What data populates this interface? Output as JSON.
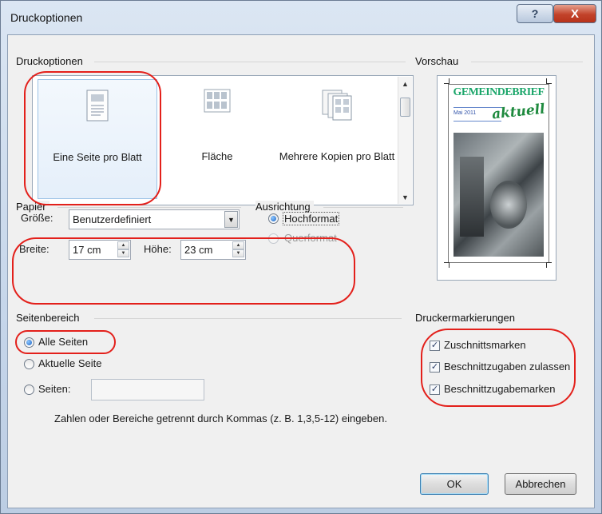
{
  "window": {
    "title": "Druckoptionen",
    "help_glyph": "?",
    "close_glyph": "X"
  },
  "layout_group": {
    "label": "Druckoptionen",
    "options": [
      {
        "label": "Eine Seite pro Blatt",
        "selected": true,
        "icon": "single-page-icon"
      },
      {
        "label": "Fläche",
        "selected": false,
        "icon": "tiled-pages-icon"
      },
      {
        "label": "Mehrere Kopien pro Blatt",
        "selected": false,
        "icon": "multiple-copies-icon"
      }
    ]
  },
  "preview": {
    "label": "Vorschau",
    "headline": "GEMEINDEBRIEF",
    "subline": "aktuell",
    "date": "Mai 2011"
  },
  "paper": {
    "label": "Papier",
    "size_label": "Größe:",
    "size_value": "Benutzerdefiniert",
    "width_label": "Breite:",
    "width_value": "17 cm",
    "height_label": "Höhe:",
    "height_value": "23 cm"
  },
  "orientation": {
    "label": "Ausrichtung",
    "portrait": "Hochformat",
    "landscape": "Querformat",
    "selected": "portrait"
  },
  "page_range": {
    "label": "Seitenbereich",
    "all": "Alle Seiten",
    "current": "Aktuelle Seite",
    "pages": "Seiten:",
    "pages_value": "",
    "hint": "Zahlen oder Bereiche getrennt durch Kommas (z. B. 1,3,5-12) eingeben."
  },
  "printer_marks": {
    "label": "Druckermarkierungen",
    "items": [
      {
        "label": "Zuschnittsmarken",
        "checked": true
      },
      {
        "label": "Beschnittzugaben zulassen",
        "checked": true
      },
      {
        "label": "Beschnittzugabemarken",
        "checked": true
      }
    ]
  },
  "buttons": {
    "ok": "OK",
    "cancel": "Abbrechen"
  },
  "colors": {
    "highlight": "#e3201b",
    "accent": "#1ba66a"
  }
}
